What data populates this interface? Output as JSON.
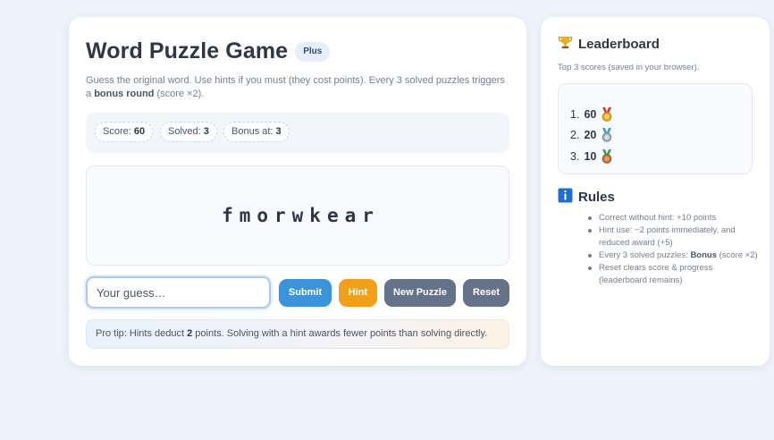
{
  "game": {
    "title": "Word Puzzle Game",
    "badge": "Plus",
    "intro_before": "Guess the original word. Use hints if you must (they cost points). Every 3 solved puzzles triggers a ",
    "intro_bold": "bonus round",
    "intro_after": " (score ×2).",
    "stats": {
      "score_label": "Score:",
      "score_value": "60",
      "solved_label": "Solved:",
      "solved_value": "3",
      "bonus_label": "Bonus at:",
      "bonus_value": "3"
    },
    "scrambled_word": "fmorwkear",
    "input": {
      "value": "",
      "placeholder": "Your guess…"
    },
    "buttons": {
      "submit": "Submit",
      "hint": "Hint",
      "new_puzzle": "New Puzzle",
      "reset": "Reset"
    },
    "tip": {
      "before": "Pro tip: Hints deduct ",
      "bold": "2",
      "after": " points. Solving with a hint awards fewer points than solving directly."
    }
  },
  "leaderboard": {
    "icon": "trophy-icon",
    "title": "Leaderboard",
    "subtitle": "Top 3 scores (saved in your browser).",
    "entries": [
      {
        "rank": "1.",
        "score": "60",
        "medal": "gold-medal-icon"
      },
      {
        "rank": "2.",
        "score": "20",
        "medal": "silver-medal-icon"
      },
      {
        "rank": "3.",
        "score": "10",
        "medal": "bronze-medal-icon"
      }
    ]
  },
  "rules": {
    "icon": "info-icon",
    "title": "Rules",
    "items": [
      {
        "text": "Correct without hint: +10 points",
        "bold": "",
        "after": ""
      },
      {
        "text": "Hint use: −2 points immediately, and reduced award (+5)",
        "bold": "",
        "after": ""
      },
      {
        "text": "Every 3 solved puzzles: ",
        "bold": "Bonus",
        "after": " (score ×2)"
      },
      {
        "text": "Reset clears score & progress (leaderboard remains)",
        "bold": "",
        "after": ""
      }
    ]
  },
  "colors": {
    "background": "#eef2fb",
    "submit": "#3b94d9",
    "hint": "#f29f1a",
    "secondary": "#65738a",
    "gold": "#e8b321",
    "silver": "#a7b3c2",
    "bronze": "#c77b3b",
    "ribbon": "#d23a3a"
  }
}
